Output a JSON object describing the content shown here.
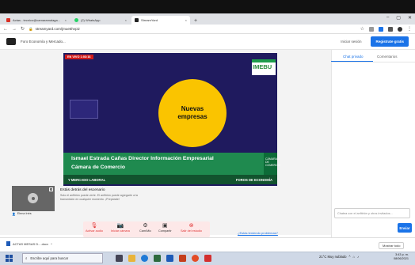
{
  "browser": {
    "tabs": [
      {
        "label": "Actas - tecnico@camaramalaga...",
        "close": "×",
        "icon_color": "#d93025"
      },
      {
        "label": "(2) WhatsApp",
        "close": "×",
        "icon_color": "#25d366"
      },
      {
        "label": "StreamYard",
        "close": "×",
        "icon_color": "#222222"
      }
    ],
    "new_tab": "+",
    "url": "streamyard.com/jmue5hvpiz"
  },
  "header": {
    "title": "Foro Economía y Mercado...",
    "login": "Iniciar sesión",
    "register": "Registrate gratis"
  },
  "stage": {
    "live_badge": "EN VIVO 1:03:16",
    "logo_text": "IMEBU",
    "circle_text_1": "Nuevas",
    "circle_text_2": "empresas",
    "name_line_1": "Ismael Estrada Cañas Director Información Empresarial",
    "name_line_2": "Cámara de Comercio",
    "left_band": "Y MERCADO LABORAL",
    "right_band": "FOROS DE ECONOMÍA",
    "corner_text": "CÁMARA DE COMERCIO"
  },
  "participant": {
    "name": "Elena Inés"
  },
  "backstage": {
    "title": "Estás detrás del escenario",
    "desc": "Solo el anfitrión puede verte. El anfitrión puede agregarte a la transmisión en cualquier momento. ¡Prepárate!"
  },
  "controls": [
    {
      "label": "Activar audio",
      "icon": "mic-off-icon",
      "glyph": "🎙",
      "red": true
    },
    {
      "label": "Iniciar cámara",
      "icon": "camera-off-icon",
      "glyph": "📷",
      "red": true
    },
    {
      "label": "Cam/Mic",
      "icon": "gear-icon",
      "glyph": "⚙",
      "red": false
    },
    {
      "label": "Compartir",
      "icon": "share-screen-icon",
      "glyph": "▣",
      "red": false
    },
    {
      "label": "Salir del estudio",
      "icon": "leave-icon",
      "glyph": "⊗",
      "red": true
    }
  ],
  "problem_link": "¿Estás teniendo problemas?",
  "side": {
    "tab_private": "Chat privado",
    "tab_comments": "Comentarios",
    "chat_placeholder": "Chatea con el anfitrión y otros invitados...",
    "send": "Enviar"
  },
  "downloads": {
    "file": "ACTAS  MESAS D....docx",
    "show_all": "Mostrar todo"
  },
  "taskbar": {
    "search": "Escribe aquí para buscar",
    "weather": "21°C  Muy nublado",
    "time": "3:43 p. m.",
    "date": "08/06/2021"
  },
  "colors": {
    "accent": "#1a73e8",
    "stage": "#1f1a5e",
    "green": "#1f8a4f",
    "yellow": "#fac400",
    "live": "#d01a1a"
  }
}
